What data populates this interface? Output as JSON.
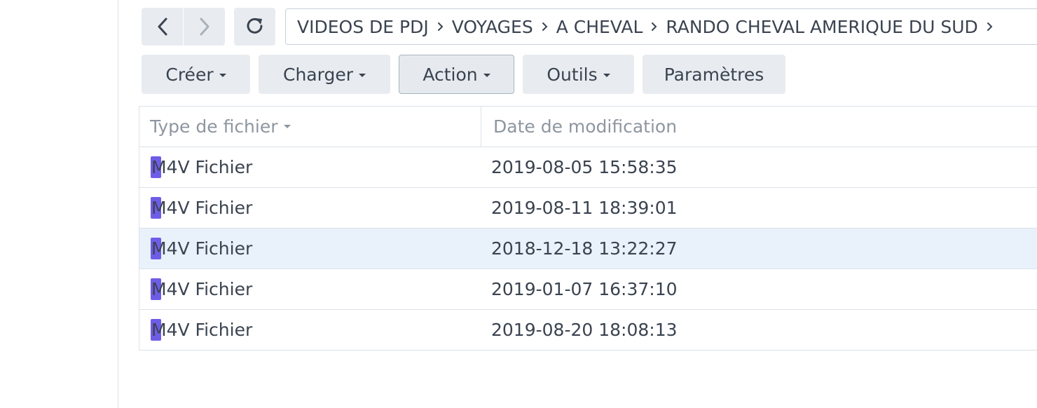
{
  "navigation": {
    "back_icon": "chevron-left-icon",
    "forward_icon": "chevron-right-icon",
    "refresh_icon": "refresh-icon"
  },
  "breadcrumb": {
    "items": [
      "VIDEOS DE PDJ",
      "VOYAGES",
      "A CHEVAL",
      "RANDO CHEVAL AMERIQUE DU SUD"
    ]
  },
  "toolbar": {
    "create_label": "Créer",
    "upload_label": "Charger",
    "action_label": "Action",
    "tools_label": "Outils",
    "settings_label": "Paramètres"
  },
  "table": {
    "columns": {
      "type": "Type de fichier",
      "modified": "Date de modification"
    },
    "rows": [
      {
        "type": "M4V Fichier",
        "modified": "2019-08-05 15:58:35",
        "selected": false
      },
      {
        "type": "M4V Fichier",
        "modified": "2019-08-11 18:39:01",
        "selected": false
      },
      {
        "type": "M4V Fichier",
        "modified": "2018-12-18 13:22:27",
        "selected": true
      },
      {
        "type": "M4V Fichier",
        "modified": "2019-01-07 16:37:10",
        "selected": false
      },
      {
        "type": "M4V Fichier",
        "modified": "2019-08-20 18:08:13",
        "selected": false
      }
    ]
  },
  "colors": {
    "file_icon": "#6f5ce6",
    "selected_row": "#e9f1fb"
  }
}
